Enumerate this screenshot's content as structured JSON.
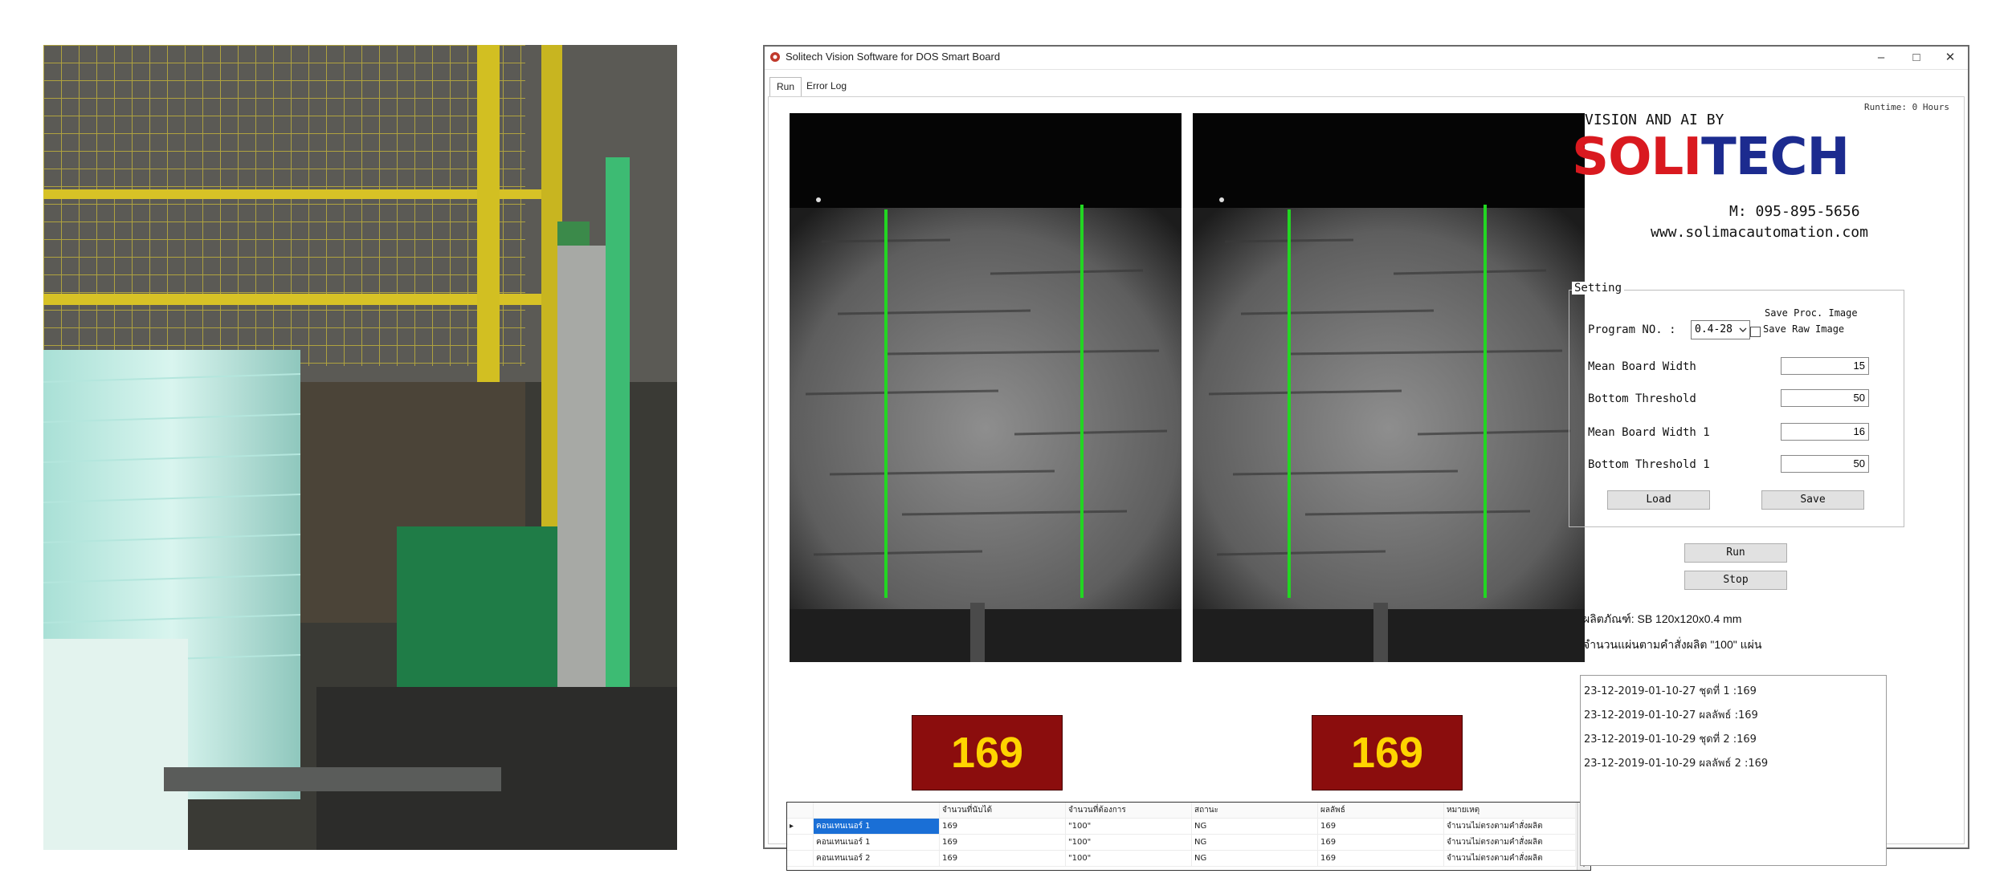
{
  "window": {
    "title": "Solitech Vision Software for DOS Smart Board",
    "minimize": "–",
    "maximize": "□",
    "close": "✕"
  },
  "tabs": [
    {
      "label": "Run"
    },
    {
      "label": "Error Log"
    }
  ],
  "runtime": "Runtime: 0 Hours",
  "brand": {
    "tagline": "VISION AND AI BY",
    "logo_red": "SOLI",
    "logo_blue": "TECH",
    "phone": "M: 095-895-5656",
    "website": "www.solimacautomation.com"
  },
  "settings": {
    "group_title": "Setting",
    "program_label": "Program NO. :",
    "program_value": "0.4-28",
    "save_proc_label": "Save Proc. Image",
    "save_raw_label": "Save Raw Image",
    "fields": [
      {
        "label": "Mean Board Width",
        "value": "15"
      },
      {
        "label": "Bottom Threshold",
        "value": "50"
      },
      {
        "label": "Mean Board Width 1",
        "value": "16"
      },
      {
        "label": "Bottom Threshold 1",
        "value": "50"
      }
    ],
    "load_button": "Load",
    "save_button": "Save"
  },
  "run_button": "Run",
  "stop_button": "Stop",
  "product_line": "ผลิตภัณฑ์: SB 120x120x0.4 mm",
  "expected_count_line": "จำนวนแผ่นตามคำสั่งผลิต \"100\" แผ่น",
  "counters": [
    "169",
    "169"
  ],
  "grid": {
    "headers": [
      "",
      "",
      "จำนวนที่นับได้",
      "จำนวนที่ต้องการ",
      "สถานะ",
      "ผลลัพธ์",
      "หมายเหตุ"
    ],
    "rows": [
      [
        "▸",
        "คอนเทนเนอร์ 1",
        "169",
        "\"100\"",
        "NG",
        "169",
        "จำนวนไม่ตรงตามคำสั่งผลิต"
      ],
      [
        "",
        "คอนเทนเนอร์ 1",
        "169",
        "\"100\"",
        "NG",
        "169",
        "จำนวนไม่ตรงตามคำสั่งผลิต"
      ],
      [
        "",
        "คอนเทนเนอร์ 2",
        "169",
        "\"100\"",
        "NG",
        "169",
        "จำนวนไม่ตรงตามคำสั่งผลิต"
      ]
    ]
  },
  "log": [
    "23-12-2019-01-10-27   ชุดที่ 1 :169",
    "23-12-2019-01-10-27   ผลลัพธ์ :169",
    "23-12-2019-01-10-29   ชุดที่ 2 :169",
    "23-12-2019-01-10-29   ผลลัพธ์ 2 :169"
  ],
  "colors": {
    "counter_bg": "#8b0d0d",
    "counter_fg": "#ffd400",
    "logo_red": "#d9191f",
    "logo_blue": "#1c2b8f",
    "edge_line": "#22d622"
  }
}
